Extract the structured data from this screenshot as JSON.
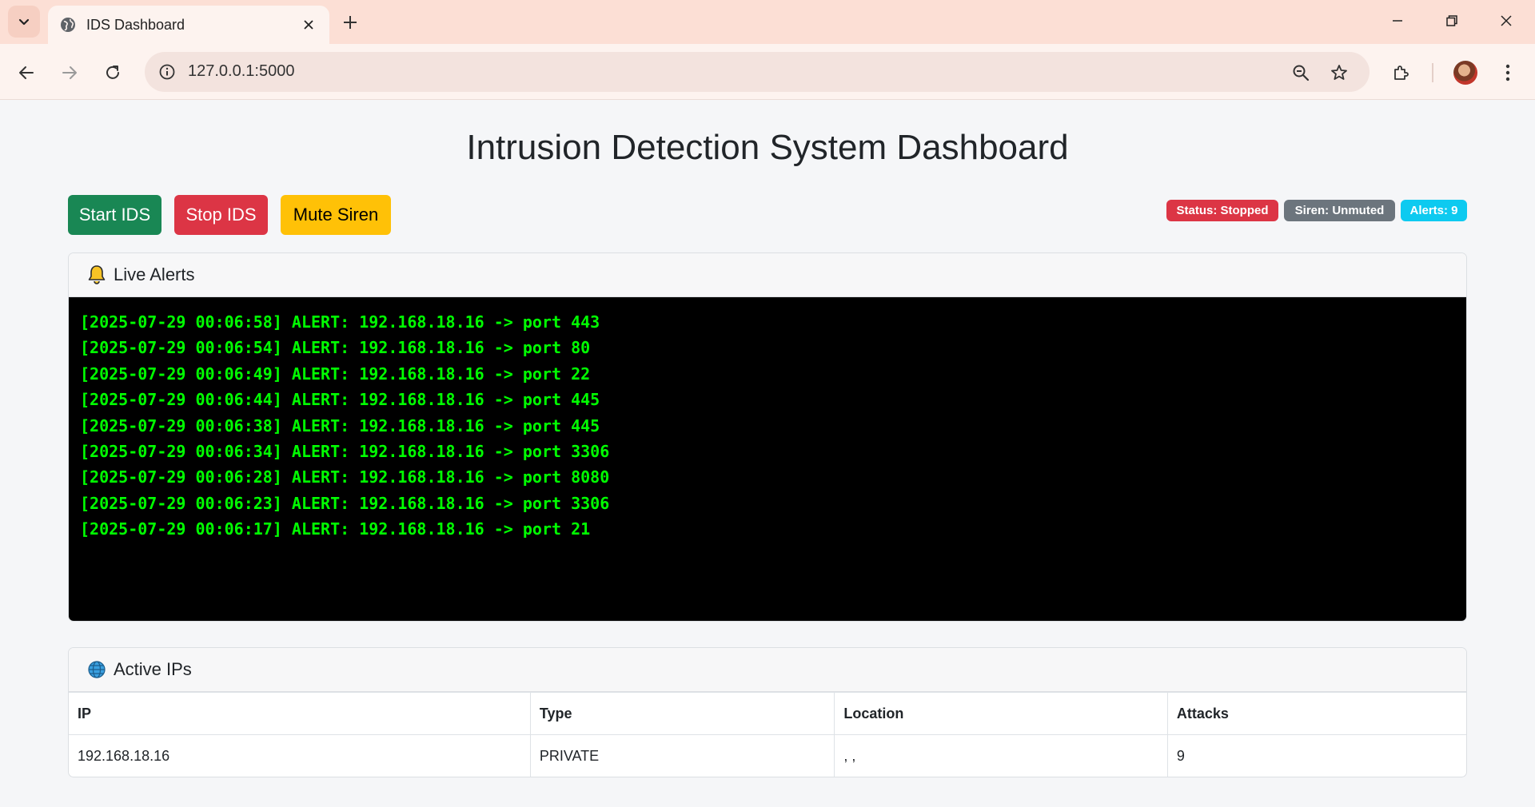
{
  "browser": {
    "tab_title": "IDS Dashboard",
    "url": "127.0.0.1:5000"
  },
  "page": {
    "title": "Intrusion Detection System Dashboard",
    "buttons": {
      "start": "Start IDS",
      "stop": "Stop IDS",
      "mute": "Mute Siren"
    },
    "badges": {
      "status": "Status: Stopped",
      "siren": "Siren: Unmuted",
      "alerts": "Alerts: 9"
    },
    "colors": {
      "success": "#198754",
      "danger": "#dc3545",
      "warning": "#ffc107",
      "secondary": "#6c757d",
      "info": "#0dcaf0",
      "terminal_text": "#00ff00"
    }
  },
  "live_alerts": {
    "header": "Live Alerts",
    "icon": "bell-icon",
    "lines": [
      "[2025-07-29 00:06:58] ALERT: 192.168.18.16 -> port 443",
      "[2025-07-29 00:06:54] ALERT: 192.168.18.16 -> port 80",
      "[2025-07-29 00:06:49] ALERT: 192.168.18.16 -> port 22",
      "[2025-07-29 00:06:44] ALERT: 192.168.18.16 -> port 445",
      "[2025-07-29 00:06:38] ALERT: 192.168.18.16 -> port 445",
      "[2025-07-29 00:06:34] ALERT: 192.168.18.16 -> port 3306",
      "[2025-07-29 00:06:28] ALERT: 192.168.18.16 -> port 8080",
      "[2025-07-29 00:06:23] ALERT: 192.168.18.16 -> port 3306",
      "[2025-07-29 00:06:17] ALERT: 192.168.18.16 -> port 21"
    ]
  },
  "active_ips": {
    "header": "Active IPs",
    "icon": "globe-icon",
    "columns": [
      "IP",
      "Type",
      "Location",
      "Attacks"
    ],
    "rows": [
      [
        "192.168.18.16",
        "PRIVATE",
        ", ,",
        "9"
      ]
    ]
  }
}
